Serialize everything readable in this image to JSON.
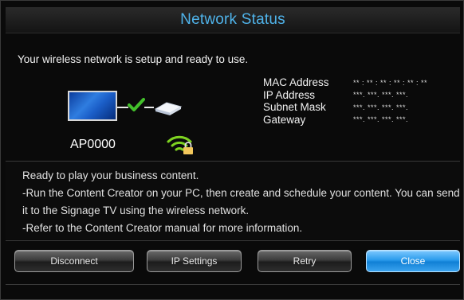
{
  "dialog": {
    "title": "Network Status",
    "status_message": "Your wireless network is setup and ready to use."
  },
  "device": {
    "ap_name": "AP0000"
  },
  "network_info": [
    {
      "label": "MAC Address",
      "value": "** : ** : ** : ** : ** : **"
    },
    {
      "label": "IP Address",
      "value": "***.   ***.   ***.   ***."
    },
    {
      "label": "Subnet Mask",
      "value": "***.   ***.   ***.   ***."
    },
    {
      "label": "Gateway",
      "value": "***.   ***.   ***.   ***."
    }
  ],
  "description": {
    "lines": [
      "Ready to play your business content.",
      "-Run the Content Creator on your PC, then create and schedule your content. You can send",
      "it to the Signage TV using the wireless network.",
      "-Refer to the Content Creator manual for more information."
    ]
  },
  "buttons": {
    "disconnect": "Disconnect",
    "ip_settings": "IP Settings",
    "retry": "Retry",
    "close": "Close"
  },
  "colors": {
    "accent": "#4fb3ea",
    "button_primary": "#2b9bec",
    "wifi_icon": "#7ed321"
  }
}
